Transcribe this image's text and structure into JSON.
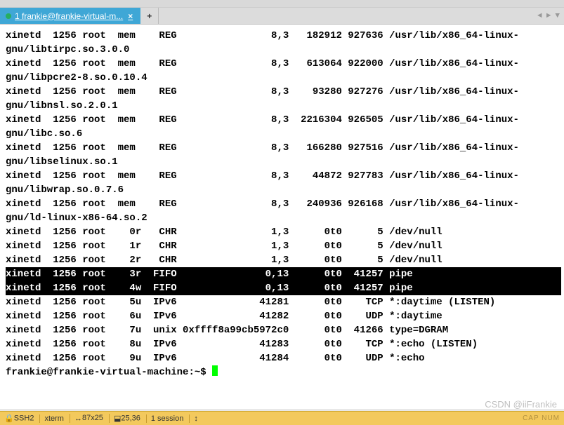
{
  "titlebar": {
    "text": ""
  },
  "tabs": {
    "active": {
      "label": "1 frankie@frankie-virtual-m..."
    },
    "new_label": "+"
  },
  "nav": {
    "left": "◄",
    "right": "►",
    "menu": "▼"
  },
  "terminal": {
    "rows": [
      {
        "sel": false,
        "parts": [
          "xinetd  1256 root  mem    REG                8,3   182912 927636 /usr/lib/x86_64-linux-"
        ]
      },
      {
        "sel": false,
        "parts": [
          "gnu/libtirpc.so.3.0.0"
        ]
      },
      {
        "sel": false,
        "parts": [
          "xinetd  1256 root  mem    REG                8,3   613064 922000 /usr/lib/x86_64-linux-"
        ]
      },
      {
        "sel": false,
        "parts": [
          "gnu/libpcre2-8.so.0.10.4"
        ]
      },
      {
        "sel": false,
        "parts": [
          "xinetd  1256 root  mem    REG                8,3    93280 927276 /usr/lib/x86_64-linux-"
        ]
      },
      {
        "sel": false,
        "parts": [
          "gnu/libnsl.so.2.0.1"
        ]
      },
      {
        "sel": false,
        "parts": [
          "xinetd  1256 root  mem    REG                8,3  2216304 926505 /usr/lib/x86_64-linux-"
        ]
      },
      {
        "sel": false,
        "parts": [
          "gnu/libc.so.6"
        ]
      },
      {
        "sel": false,
        "parts": [
          "xinetd  1256 root  mem    REG                8,3   166280 927516 /usr/lib/x86_64-linux-"
        ]
      },
      {
        "sel": false,
        "parts": [
          "gnu/libselinux.so.1"
        ]
      },
      {
        "sel": false,
        "parts": [
          "xinetd  1256 root  mem    REG                8,3    44872 927783 /usr/lib/x86_64-linux-"
        ]
      },
      {
        "sel": false,
        "parts": [
          "gnu/libwrap.so.0.7.6"
        ]
      },
      {
        "sel": false,
        "parts": [
          "xinetd  1256 root  mem    REG                8,3   240936 926168 /usr/lib/x86_64-linux-"
        ]
      },
      {
        "sel": false,
        "parts": [
          "gnu/ld-linux-x86-64.so.2"
        ]
      },
      {
        "sel": false,
        "parts": [
          "xinetd  1256 root    0r   CHR                1,3      0t0      5 /dev/null"
        ]
      },
      {
        "sel": false,
        "parts": [
          "xinetd  1256 root    1r   CHR                1,3      0t0      5 /dev/null"
        ]
      },
      {
        "sel": false,
        "parts": [
          "xinetd  1256 root    2r   CHR                1,3      0t0      5 /dev/null"
        ]
      },
      {
        "sel": true,
        "parts": [
          "xinetd  1256 root    3r  FIFO               0,13      0t0  41257 pipe"
        ]
      },
      {
        "sel": true,
        "parts": [
          "xinetd  1256 root    4w  FIFO               0,13      0t0  41257 pipe"
        ]
      },
      {
        "sel": false,
        "parts": [
          "xinetd  1256 root    5u  IPv6              41281      0t0    TCP *:daytime (LISTEN)"
        ]
      },
      {
        "sel": false,
        "parts": [
          "xinetd  1256 root    6u  IPv6              41282      0t0    UDP *:daytime"
        ]
      },
      {
        "sel": false,
        "parts": [
          "xinetd  1256 root    7u  unix 0xffff8a99cb5972c0      0t0  41266 type=DGRAM"
        ]
      },
      {
        "sel": false,
        "parts": [
          "xinetd  1256 root    8u  IPv6              41283      0t0    TCP *:echo (LISTEN)"
        ]
      },
      {
        "sel": false,
        "parts": [
          "xinetd  1256 root    9u  IPv6              41284      0t0    UDP *:echo"
        ]
      }
    ],
    "prompt": "frankie@frankie-virtual-machine:~$ "
  },
  "status": {
    "proto": "SSH2",
    "term": "xterm",
    "size": "87x25",
    "pos": "25,36",
    "sessions": "1 session",
    "caps": "CAP  NUM"
  },
  "watermark": "CSDN @iiFrankie"
}
